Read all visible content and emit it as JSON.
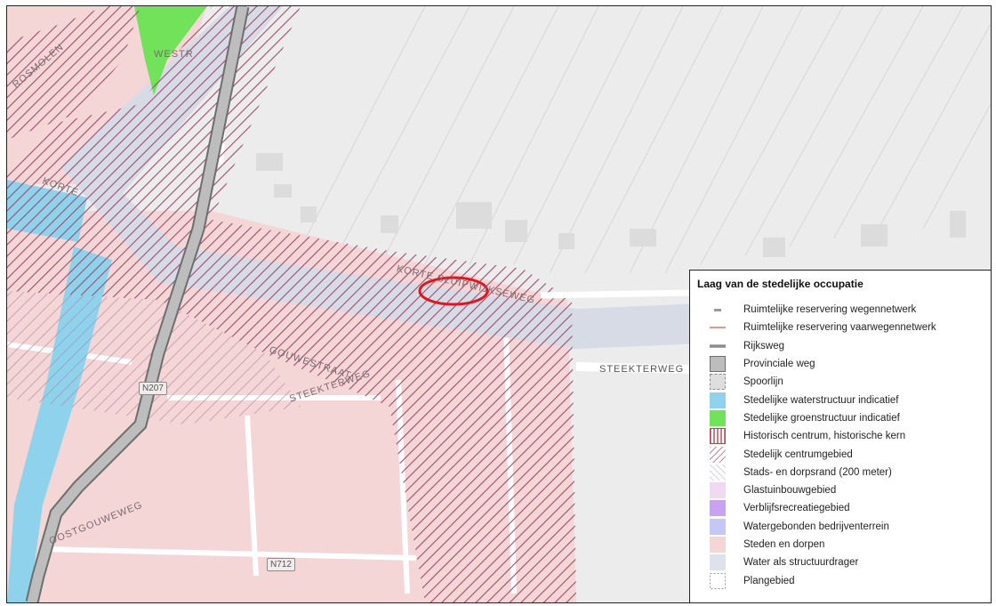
{
  "map": {
    "street_labels": [
      "ROSMOLEN",
      "KORTE",
      "WESTR",
      "KORTE SLUIPWIJKSEWEG",
      "STEEKTERWEG",
      "GOUWESTRAAT",
      "STEEKTERWEG",
      "OOSTGOUWEWEG"
    ],
    "road_shields": [
      "N207",
      "N712"
    ],
    "highlight": {
      "shape": "ellipse",
      "color": "#e0161e"
    }
  },
  "legend": {
    "title": "Laag van de stedelijke occupatie",
    "items": [
      {
        "label": "Ruimtelijke reservering wegennetwerk",
        "symbol": "dash-grey",
        "color": "#9a9a9a"
      },
      {
        "label": "Ruimtelijke reservering vaarwegennetwerk",
        "symbol": "line-red",
        "color": "#e07070"
      },
      {
        "label": "Rijksweg",
        "symbol": "thick-grey-line",
        "color": "#8c8c8c"
      },
      {
        "label": "Provinciale weg",
        "symbol": "grey-box",
        "color": "#bdbdbd"
      },
      {
        "label": "Spoorlijn",
        "symbol": "dashed-box",
        "color": "#dedede"
      },
      {
        "label": "Stedelijke waterstructuur indicatief",
        "symbol": "fill",
        "color": "#8fd2ec"
      },
      {
        "label": "Stedelijke groenstructuur indicatief",
        "symbol": "fill",
        "color": "#72e25a"
      },
      {
        "label": "Historisch centrum, historische kern",
        "symbol": "vertical-hatch",
        "color": "#a84a5a"
      },
      {
        "label": "Stedelijk centrumgebied",
        "symbol": "diagonal-hatch",
        "color": "#a05070"
      },
      {
        "label": "Stads- en dorpsrand (200 meter)",
        "symbol": "light-hatch",
        "color": "#c8a8c8"
      },
      {
        "label": "Glastuinbouwgebied",
        "symbol": "fill",
        "color": "#f2d9f2"
      },
      {
        "label": "Verblijfsrecreatiegebied",
        "symbol": "fill",
        "color": "#c9a3f0"
      },
      {
        "label": "Watergebonden bedrijventerrein",
        "symbol": "fill",
        "color": "#c4c8f2"
      },
      {
        "label": "Steden en dorpen",
        "symbol": "fill",
        "color": "#f5d6d6"
      },
      {
        "label": "Water als structuurdrager",
        "symbol": "fill",
        "color": "#dde2ec"
      },
      {
        "label": "Plangebied",
        "symbol": "dashed-outline",
        "color": "#999999"
      }
    ]
  }
}
